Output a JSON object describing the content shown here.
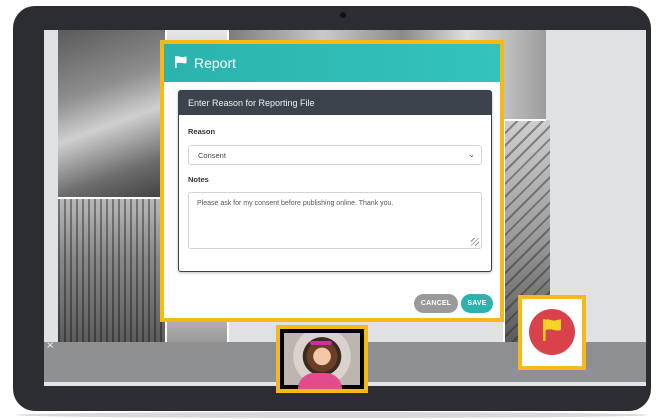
{
  "modal": {
    "title": "Report",
    "panel_title": "Enter Reason for Reporting File",
    "reason_label": "Reason",
    "reason_value": "Consent",
    "notes_label": "Notes",
    "notes_value": "Please ask for my consent before publishing online. Thank you.",
    "cancel_label": "CANCEL",
    "save_label": "SAVE"
  },
  "strip": {
    "close_glyph": "×"
  },
  "icons": {
    "header_flag": "flag-icon",
    "report_flag": "flag-icon",
    "chevron": "chevron-down-icon"
  },
  "colors": {
    "accent": "#2bb3ad",
    "highlight": "#f7b916",
    "report_button": "#d9424a",
    "flag": "#f7d22a",
    "panel_header": "#3c434d",
    "cancel": "#9a9a9a"
  }
}
